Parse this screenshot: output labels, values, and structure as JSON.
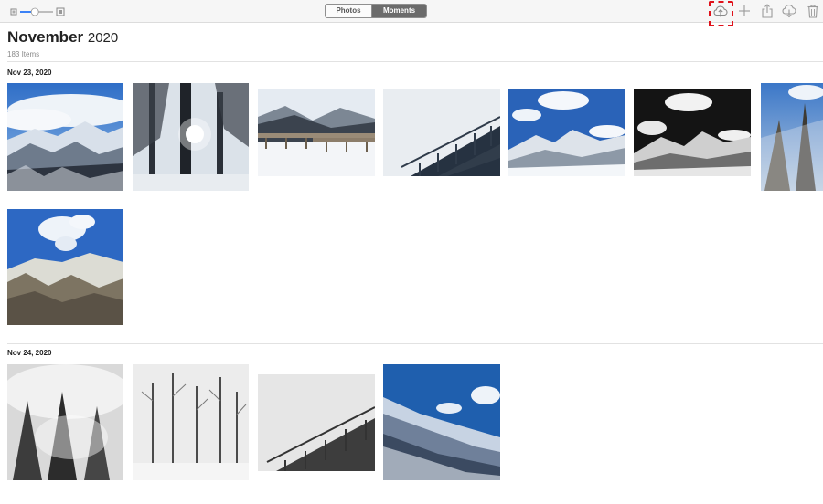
{
  "toolbar": {
    "tabs": [
      {
        "label": "Photos",
        "selected": false
      },
      {
        "label": "Moments",
        "selected": true
      }
    ],
    "zoom_level": 0.45,
    "actions": [
      "upload-to-cloud-icon",
      "add-icon",
      "share-icon",
      "download-from-cloud-icon",
      "trash-icon"
    ],
    "highlight_color": "#e0121b"
  },
  "header": {
    "month": "November",
    "year": "2020",
    "count": "183 Items"
  },
  "moments": [
    {
      "date": "Nov 23, 2020",
      "photo_count": 8
    },
    {
      "date": "Nov 24, 2020",
      "photo_count": 4
    }
  ]
}
